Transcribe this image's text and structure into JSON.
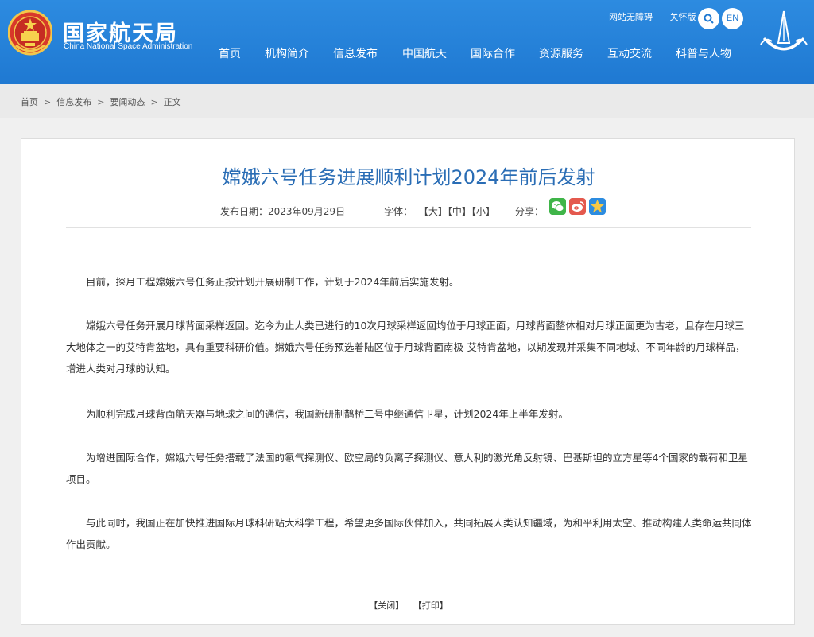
{
  "header": {
    "title_cn": "国家航天局",
    "title_en": "China National Space Administration",
    "accessibility_link": "网站无障碍",
    "care_mode_link": "关怀版",
    "lang_button": "EN",
    "nav": [
      "首页",
      "机构简介",
      "信息发布",
      "中国航天",
      "国际合作",
      "资源服务",
      "互动交流",
      "科普与人物"
    ]
  },
  "breadcrumb": [
    "首页",
    "信息发布",
    "要闻动态",
    "正文"
  ],
  "article": {
    "title": "嫦娥六号任务进展顺利计划2024年前后发射",
    "publish_date": "发布日期：2023年09月29日",
    "font_label": "字体：",
    "font_large": "【大】",
    "font_medium": "【中】",
    "font_small": "【小】",
    "share_label": "分享：",
    "paragraphs": [
      "目前，探月工程嫦娥六号任务正按计划开展研制工作，计划于2024年前后实施发射。",
      "嫦娥六号任务开展月球背面采样返回。迄今为止人类已进行的10次月球采样返回均位于月球正面，月球背面整体相对月球正面更为古老，且存在月球三大地体之一的艾特肯盆地，具有重要科研价值。嫦娥六号任务预选着陆区位于月球背面南极-艾特肯盆地，以期发现并采集不同地域、不同年龄的月球样品，增进人类对月球的认知。",
      "为顺利完成月球背面航天器与地球之间的通信，我国新研制鹊桥二号中继通信卫星，计划2024年上半年发射。",
      "为增进国际合作，嫦娥六号任务搭载了法国的氡气探测仪、欧空局的负离子探测仪、意大利的激光角反射镜、巴基斯坦的立方星等4个国家的载荷和卫星项目。",
      "与此同时，我国正在加快推进国际月球科研站大科学工程，希望更多国际伙伴加入，共同拓展人类认知疆域，为和平利用太空、推动构建人类命运共同体作出贡献。"
    ],
    "close_label": "【关闭】",
    "print_label": "【打印】"
  },
  "colors": {
    "header_blue": "#2386de",
    "title_blue": "#2a6db5"
  },
  "icons": [
    "national-emblem-icon",
    "search-icon",
    "wechat-icon",
    "weibo-icon",
    "qzone-icon",
    "cnsa-logo-icon"
  ]
}
